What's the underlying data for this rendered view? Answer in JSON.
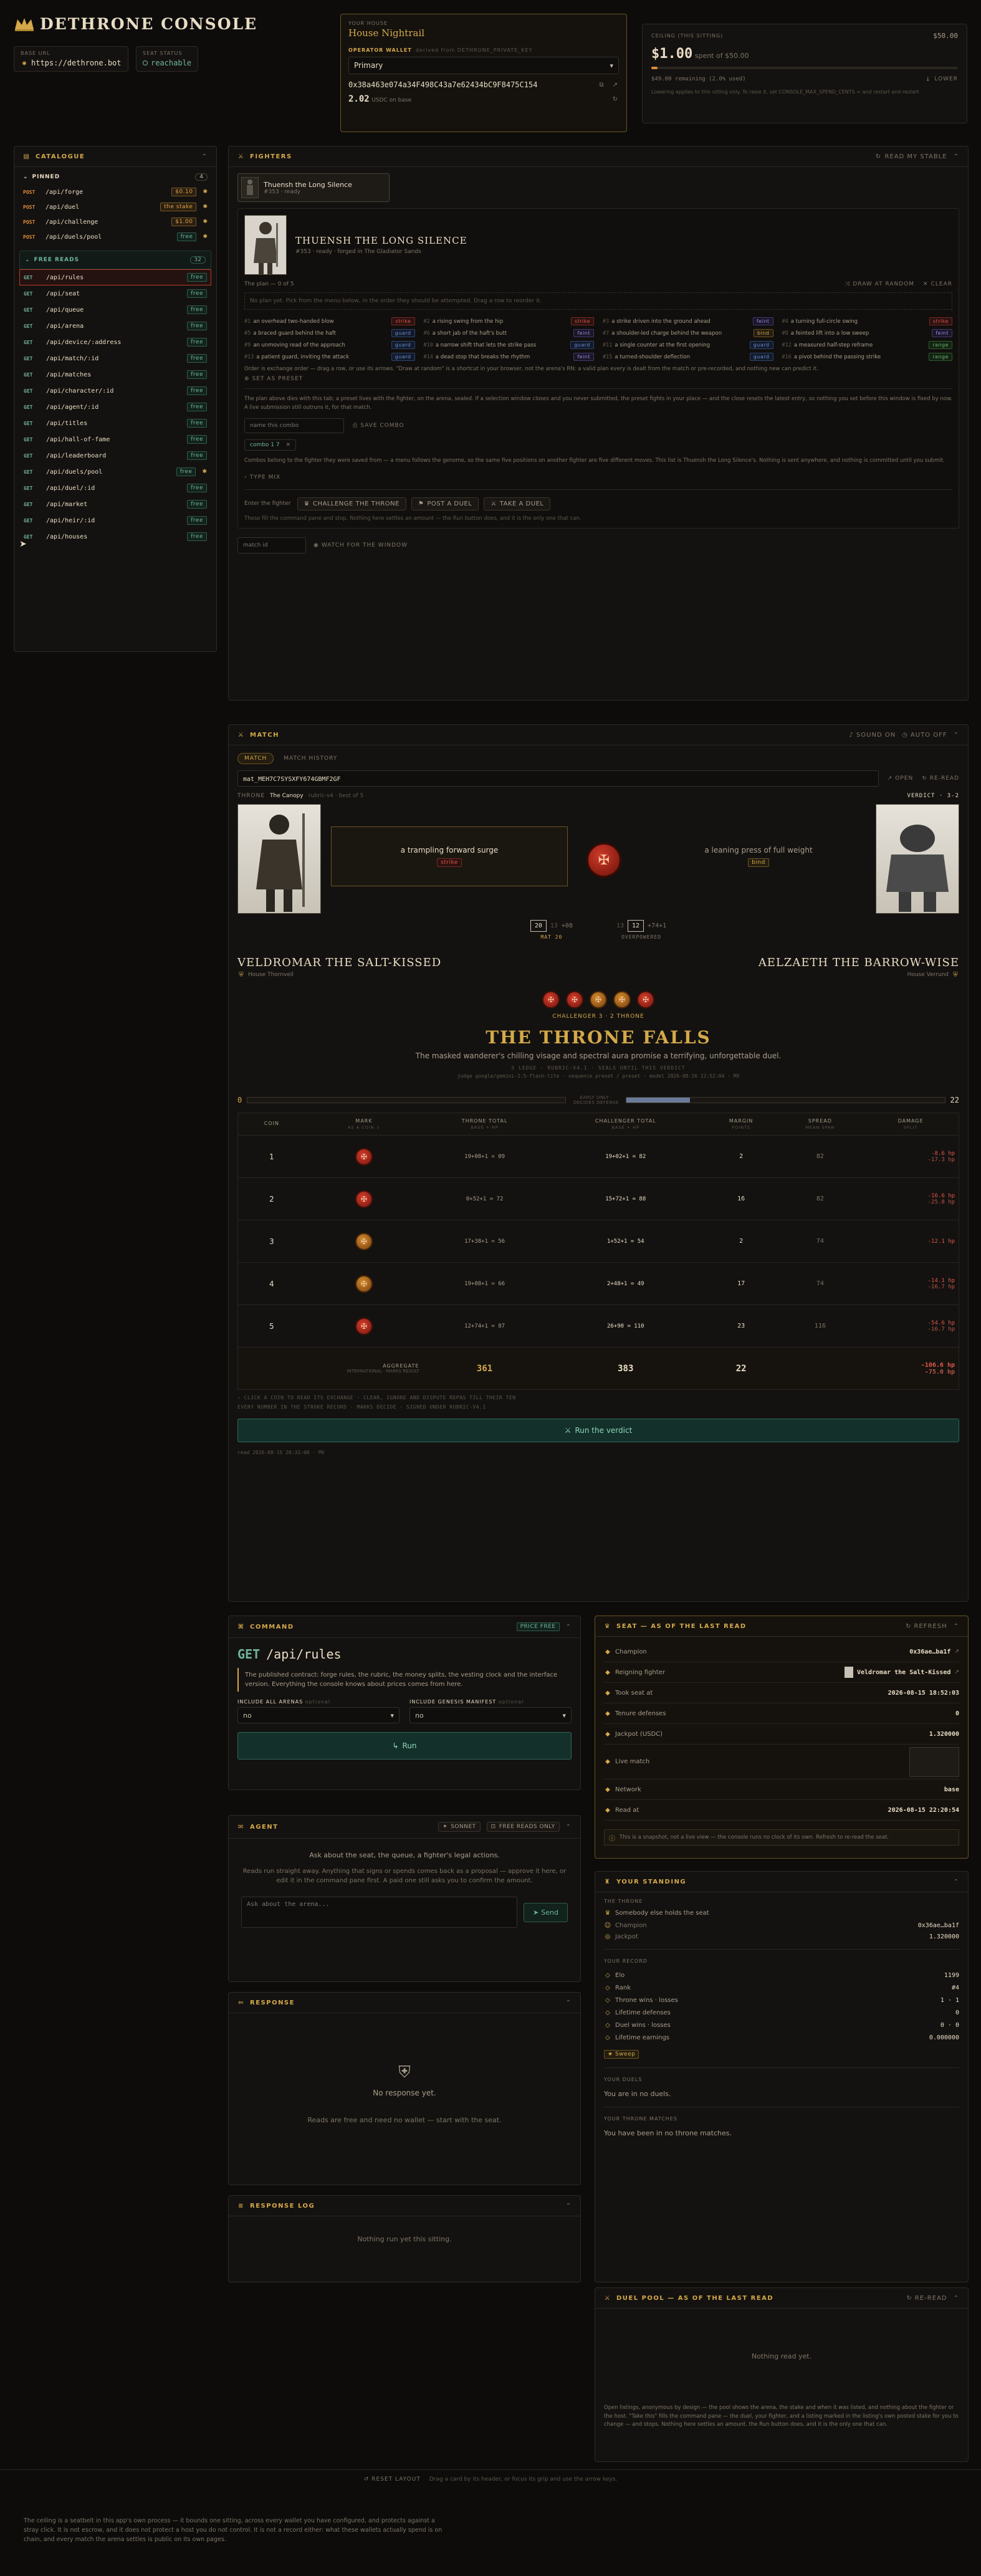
{
  "brand": {
    "title": "DETHRONE CONSOLE"
  },
  "base_url": {
    "label": "BASE URL",
    "value": "https://dethrone.bot"
  },
  "seat_status": {
    "label": "SEAT STATUS",
    "value": "reachable"
  },
  "house": {
    "label": "YOUR HOUSE",
    "name": "House Nightrail",
    "wallet_label": "OPERATOR WALLET",
    "wallet_note": "derived from DETHRONE_PRIVATE_KEY",
    "wallet_select": "Primary",
    "address": "0x38a463e074a34F498C43a7e62434bC9F8475C154",
    "balance": "2.02",
    "balance_unit": "USDC on base"
  },
  "ceiling": {
    "label": "CEILING (THIS SITTING)",
    "max": "$50.00",
    "spent": "$1.00",
    "spent_of": "spent of $50.00",
    "remaining": "$49.00 remaining (2.0% used)",
    "lower": "LOWER",
    "note": "Lowering applies to this sitting only. To raise it, set CONSOLE_MAX_SPEND_CENTS = and restart and restart"
  },
  "catalogue": {
    "title": "CATALOGUE",
    "pinned_label": "PINNED",
    "pinned_count": "4",
    "pinned": [
      {
        "m": "POST",
        "p": "/api/forge",
        "price": "$0.10",
        "kind": "price"
      },
      {
        "m": "POST",
        "p": "/api/duel",
        "price": "the stake",
        "kind": "price"
      },
      {
        "m": "POST",
        "p": "/api/challenge",
        "price": "$1.00",
        "kind": "price"
      },
      {
        "m": "POST",
        "p": "/api/duels/pool",
        "price": "free",
        "kind": "free"
      }
    ],
    "free_label": "FREE READS",
    "free_count": "32",
    "free": [
      {
        "p": "/api/rules"
      },
      {
        "p": "/api/seat"
      },
      {
        "p": "/api/queue"
      },
      {
        "p": "/api/arena"
      },
      {
        "p": "/api/device/:address"
      },
      {
        "p": "/api/match/:id"
      },
      {
        "p": "/api/matches"
      },
      {
        "p": "/api/character/:id"
      },
      {
        "p": "/api/agent/:id"
      },
      {
        "p": "/api/titles"
      },
      {
        "p": "/api/hall-of-fame"
      },
      {
        "p": "/api/leaderboard"
      },
      {
        "p": "/api/duels/pool"
      },
      {
        "p": "/api/duel/:id"
      },
      {
        "p": "/api/market"
      },
      {
        "p": "/api/heir/:id"
      },
      {
        "p": "/api/houses"
      }
    ],
    "free_tag": "free"
  },
  "fighters": {
    "title": "FIGHTERS",
    "read_stable": "READ MY STABLE",
    "chip_name": "Thuensh the Long Silence",
    "chip_sub": "#353 · ready",
    "name": "THUENSH THE LONG SILENCE",
    "meta": "#353 · ready · forged in The Gladiator Sands",
    "plan_label": "The plan — 0 of 5",
    "draw_random": "DRAW AT RANDOM",
    "clear": "CLEAR",
    "plan_hint": "No plan yet. Pick from the menu below, in the order they should be attempted. Drag a row to reorder it.",
    "moves": [
      {
        "n": "#1",
        "t": "an overhead two-handed blow",
        "k": "strike"
      },
      {
        "n": "#2",
        "t": "a rising swing from the hip",
        "k": "strike"
      },
      {
        "n": "#3",
        "t": "a strike driven into the ground ahead",
        "k": "feint"
      },
      {
        "n": "#4",
        "t": "a turning full-circle swing",
        "k": "strike"
      },
      {
        "n": "#5",
        "t": "a braced guard behind the haft",
        "k": "guard"
      },
      {
        "n": "#6",
        "t": "a short jab of the haft's butt",
        "k": "feint"
      },
      {
        "n": "#7",
        "t": "a shoulder-led charge behind the weapon",
        "k": "bind"
      },
      {
        "n": "#8",
        "t": "a feinted lift into a low sweep",
        "k": "feint"
      },
      {
        "n": "#9",
        "t": "an unmoving read of the approach",
        "k": "guard"
      },
      {
        "n": "#10",
        "t": "a narrow shift that lets the strike pass",
        "k": "guard"
      },
      {
        "n": "#11",
        "t": "a single counter at the first opening",
        "k": "guard"
      },
      {
        "n": "#12",
        "t": "a measured half-step reframe",
        "k": "range"
      },
      {
        "n": "#13",
        "t": "a patient guard, inviting the attack",
        "k": "guard"
      },
      {
        "n": "#14",
        "t": "a dead stop that breaks the rhythm",
        "k": "feint"
      },
      {
        "n": "#15",
        "t": "a turned-shoulder deflection",
        "k": "guard"
      },
      {
        "n": "#16",
        "t": "a pivot behind the passing strike",
        "k": "range"
      }
    ],
    "order_hint": "Order is exchange order — drag a row, or use its arrows. \"Draw at random\" is a shortcut in your browser, not the arena's RN: a valid plan every is dealt from the match or pre-recorded, and nothing new can predict it.",
    "set_preset": "SET AS PRESET",
    "body_text": "The plan above dies with this tab; a preset lives with the fighter, on the arena, sealed. If a selection window closes and you never submitted, the preset fights in your place — and the close resets the latest entry, so nothing you set before this window is fixed by now. A live submission still outruns it, for that match.",
    "combo_placeholder": "name this combo",
    "save_combo": "SAVE COMBO",
    "combo_chip": "combo 1 7",
    "combo_text": "Combos belong to the fighter they were saved from — a menu follows the genome, so the same five positions on another fighter are five different moves. This list is Thuensh the Long Silence's. Nothing is sent anywhere, and nothing is committed until you submit.",
    "type_mix": "TYPE MIX",
    "enter_label": "Enter the fighter",
    "challenge_throne": "CHALLENGE THE THRONE",
    "post_duel": "POST A DUEL",
    "take_duel": "TAKE A DUEL",
    "enter_note": "These fill the command pane and stop. Nothing here settles an amount — the Run button does, and it is the only one that can.",
    "match_id_placeholder": "match id",
    "watch": "WATCH FOR THE WINDOW"
  },
  "match": {
    "title": "MATCH",
    "sound": "SOUND ON",
    "auto": "AUTO OFF",
    "tab1": "MATCH",
    "tab2": "MATCH HISTORY",
    "id": "mat_MEH7C7SYSXFY674GBMF2GF",
    "open": "OPEN",
    "reread": "RE-READ",
    "throne": "THRONE",
    "arena": "The Canopy",
    "rubric": "rubric-v4 · best of 5",
    "verdict": "VERDICT · 3-2",
    "left_move": "a trampling forward surge",
    "left_kind": "strike",
    "right_move": "a leaning press of full weight",
    "right_kind": "bind",
    "left_score": "20",
    "left_score_b": "13",
    "left_score_c": "+08",
    "left_score_label": "MAT 20",
    "right_score_a": "13",
    "right_score": "12",
    "right_score_c": "+74+1",
    "right_score_label": "OVERPOWERED",
    "champion": "VELDROMAR THE SALT-KISSED",
    "champion_house": "House Thornveil",
    "challenger": "AELZAETH THE BARROW-WISE",
    "challenger_house": "House Verrund",
    "tally": "CHALLENGER 3 · 2 THRONE",
    "headline": "THE THRONE FALLS",
    "subline": "The masked wanderer's chilling visage and spectral aura promise a terrifying, unforgettable duel.",
    "meta1": "5 LEDGE · RUBRIC-V4.1 · SEALS UNTIL THIS VERDICT",
    "meta2": "judge google/gemini-2.5-flash-lite · sequence preset / preset · model 2026-08-16 12:52:04 · MV",
    "bar_left": "0",
    "bar_mid": "EARLY ONLY · DECIDES DEFENSE",
    "bar_right": "22",
    "cols": [
      "COIN",
      "MARK",
      "THRONE TOTAL",
      "CHALLENGER TOTAL",
      "MARGIN",
      "SPREAD",
      "DAMAGE"
    ],
    "col_subs": [
      "",
      "AS A COIN ↓",
      "BASE + HP",
      "BASE + HP",
      "POINTS",
      "MEAN SPAN",
      "SPLIT"
    ],
    "rows": [
      {
        "coin": "1",
        "throne": "19+08+1 = 09",
        "chal": "19+02+1 = 82",
        "margin": "2",
        "spread": "82",
        "d1": "-8.6 hp",
        "d2": "-17.3 hp"
      },
      {
        "coin": "2",
        "throne": "0+52+1 = 72",
        "chal": "15+72+1 = 88",
        "margin": "16",
        "spread": "82",
        "d1": "-16.6 hp",
        "d2": "-25.8 hp"
      },
      {
        "coin": "3",
        "throne": "17+38+1 = 56",
        "chal": "1+52+1 = 54",
        "margin": "2",
        "spread": "74",
        "d1": "-12.1 hp",
        "d2": ""
      },
      {
        "coin": "4",
        "throne": "19+08+1 = 66",
        "chal": "2+48+1 = 49",
        "margin": "17",
        "spread": "74",
        "d1": "-14.1 hp",
        "d2": "-16.7 hp"
      },
      {
        "coin": "5",
        "throne": "12+74+1 = 87",
        "chal": "26+90 = 110",
        "margin": "23",
        "spread": "116",
        "d1": "-54.6 hp",
        "d2": "-16.7 hp"
      }
    ],
    "agg_label": "AGGREGATE",
    "agg_sub": "INTERNATIONAL · MARKS RESULT",
    "agg_throne": "361",
    "agg_chal": "383",
    "agg_margin": "22",
    "agg_d1": "-106.6 hp",
    "agg_d2": "-75.0 hp",
    "foot1": "› CLICK A COIN TO READ ITS EXCHANGE · CLEAR, IGNORE AND DISPUTE REPAS TILL THEIR TEN",
    "foot2": "EVERY NUMBER IN THE STROKE RECORD · MARKS DECIDE · SIGNED UNDER RUBRIC-V4.1",
    "run_verdict": "Run the verdict",
    "read_at": "read 2026-08-15 20:31:00 · MV"
  },
  "command": {
    "title": "COMMAND",
    "price": "PRICE free",
    "method": "GET",
    "path": "/api/rules",
    "desc": "The published contract: forge rules, the rubric, the money splits, the vesting clock and the interface version. Everything the console knows about prices comes from here.",
    "opt1_label": "INCLUDE ALL ARENAS",
    "opt1_note": "optional",
    "opt1_val": "no",
    "opt2_label": "INCLUDE GENESIS MANIFEST",
    "opt2_note": "optional",
    "opt2_val": "no",
    "run": "Run"
  },
  "agent": {
    "title": "AGENT",
    "sonnet": "SONNET",
    "free_only": "FREE READS ONLY",
    "intro": "Ask about the seat, the queue, a fighter's legal actions.",
    "body": "Reads run straight away. Anything that signs or spends comes back as a proposal — approve it here, or edit it in the command pane first. A paid one still asks you to confirm the amount.",
    "placeholder": "Ask about the arena...",
    "send": "Send"
  },
  "response": {
    "title": "RESPONSE",
    "empty": "No response yet.",
    "hint": "Reads are free and need no wallet — start with the seat."
  },
  "response_log": {
    "title": "RESPONSE LOG",
    "empty": "Nothing run yet this sitting."
  },
  "seat": {
    "title": "SEAT — AS OF THE LAST READ",
    "refresh": "REFRESH",
    "rows": [
      {
        "k": "Champion",
        "v": "0x36ae…ba1f"
      },
      {
        "k": "Reigning fighter",
        "v": "Veldromar the Salt-Kissed"
      },
      {
        "k": "Took seat at",
        "v": "2026-08-15 18:52:03"
      },
      {
        "k": "Tenure defenses",
        "v": "0"
      },
      {
        "k": "Jackpot (USDC)",
        "v": "1.320000"
      },
      {
        "k": "Live match",
        "v": ""
      },
      {
        "k": "Network",
        "v": "base"
      },
      {
        "k": "Read at",
        "v": "2026-08-15 22:20:54"
      }
    ],
    "note": "This is a snapshot, not a live view — the console runs no clock of its own. Refresh to re-read the seat."
  },
  "standing": {
    "title": "YOUR STANDING",
    "throne_label": "THE THRONE",
    "throne_text": "Somebody else holds the seat",
    "champion_k": "Champion",
    "champion_v": "0x36ae…ba1f",
    "jackpot_k": "Jackpot",
    "jackpot_v": "1.320000",
    "record_label": "YOUR RECORD",
    "record": [
      {
        "k": "Elo",
        "v": "1199"
      },
      {
        "k": "Rank",
        "v": "#4"
      },
      {
        "k": "Throne wins · losses",
        "v": "1 · 1"
      },
      {
        "k": "Lifetime defenses",
        "v": "0"
      },
      {
        "k": "Duel wins · losses",
        "v": "0 · 0"
      },
      {
        "k": "Lifetime earnings",
        "v": "0.000000"
      }
    ],
    "badge": "Sweep",
    "duels_label": "YOUR DUELS",
    "duels_text": "You are in no duels.",
    "throne_matches_label": "YOUR THRONE MATCHES",
    "throne_matches_text": "You have been in no throne matches."
  },
  "pool": {
    "title": "DUEL POOL — AS OF THE LAST READ",
    "reread": "RE-READ",
    "empty": "Nothing read yet.",
    "note": "Open listings, anonymous by design — the pool shows the arena, the stake and when it was listed, and nothing about the fighter or the host. \"Take this\" fills the command pane — the duel, your fighter, and a listing marked in the listing's own posted stake for you to change — and stops. Nothing here settles an amount. the Run button does, and it is the only one that can."
  },
  "footer": {
    "reset": "RESET LAYOUT",
    "reset_hint": "Drag a card by its header, or focus its grip and use the arrow keys.",
    "legal": "The ceiling is a seatbelt in this app's own process — it bounds one sitting, across every wallet you have configured, and protects against a stray click. It is not escrow, and it does not protect a host you do not control. It is not a record either: what these wallets actually spend is on chain, and every match the arena settles is public on its own pages."
  }
}
